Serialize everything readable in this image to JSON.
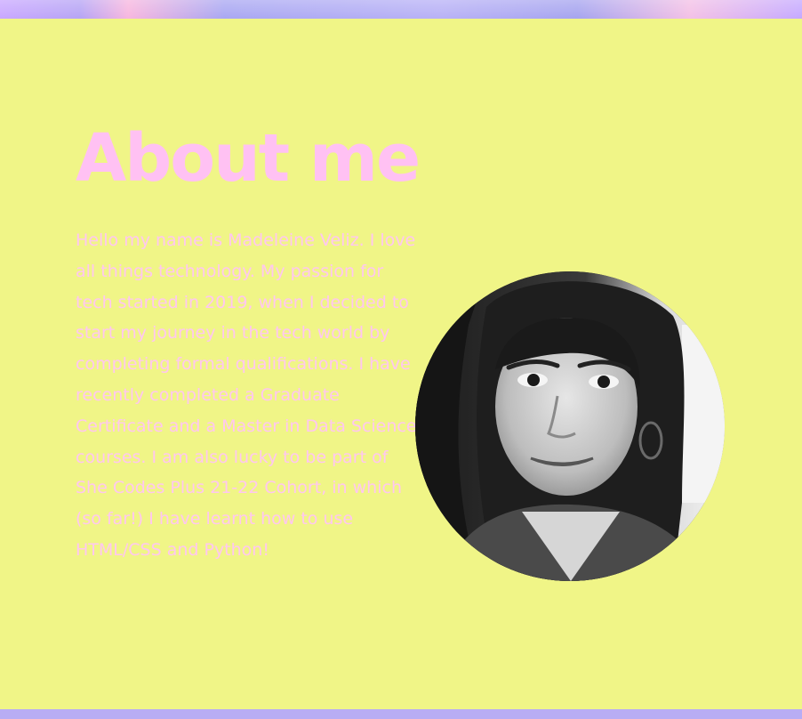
{
  "about": {
    "title": "About me",
    "bio": "Hello my name is Madeleine Veliz. I love all things technology. My passion for tech started in 2019, when I decided to start my journey in the tech world by completing formal qualifications. I have recently completed a Graduate Certificate and a Master in Data Science courses. I am also lucky to be part of She Codes Plus 21-22 Cohort, in which (so far!) I have learnt how to use HTML/CSS and Python!",
    "photo_alt": "Madeleine Veliz"
  },
  "colors": {
    "background": "#f0f587",
    "accent_pink": "#ffc1f3",
    "strip_lavender": "#b8adf4"
  }
}
